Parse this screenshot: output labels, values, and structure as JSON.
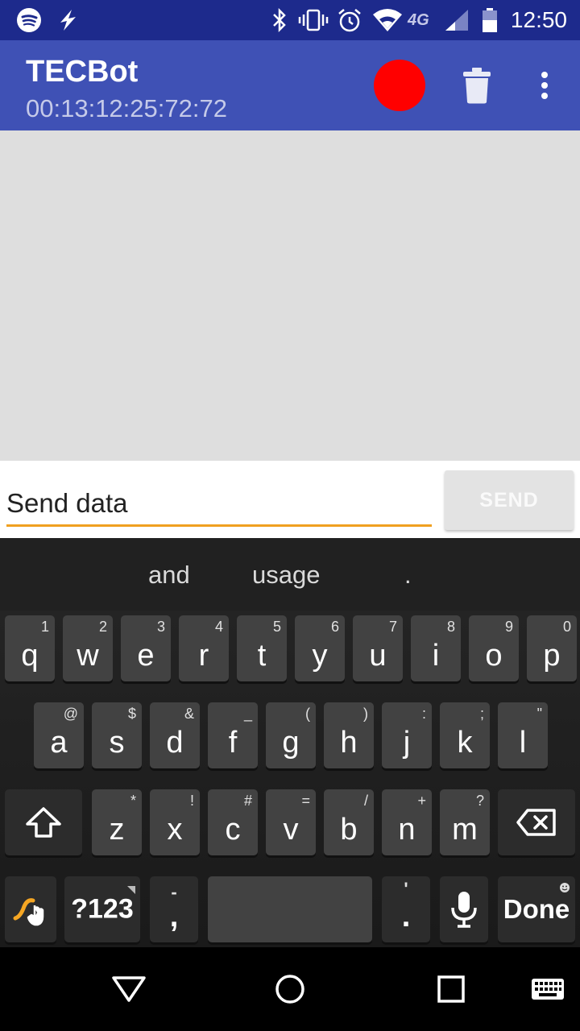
{
  "status_bar": {
    "time": "12:50",
    "network_label": "4G",
    "icons": [
      "spotify-icon",
      "flash-icon",
      "bluetooth-icon",
      "vibrate-icon",
      "alarm-icon",
      "wifi-icon",
      "lte-icon",
      "signal-icon",
      "battery-icon"
    ]
  },
  "app_bar": {
    "title": "TECBot",
    "subtitle": "00:13:12:25:72:72",
    "record_color": "#ff0000",
    "actions": [
      "record-button",
      "trash-icon",
      "more-vert-icon"
    ]
  },
  "composer": {
    "input_value": "",
    "input_placeholder": "Send data",
    "send_label": "SEND"
  },
  "keyboard": {
    "suggestions": [
      "and",
      "usage",
      "."
    ],
    "row1": [
      {
        "key": "q",
        "hint": "1"
      },
      {
        "key": "w",
        "hint": "2"
      },
      {
        "key": "e",
        "hint": "3"
      },
      {
        "key": "r",
        "hint": "4"
      },
      {
        "key": "t",
        "hint": "5"
      },
      {
        "key": "y",
        "hint": "6"
      },
      {
        "key": "u",
        "hint": "7"
      },
      {
        "key": "i",
        "hint": "8"
      },
      {
        "key": "o",
        "hint": "9"
      },
      {
        "key": "p",
        "hint": "0"
      }
    ],
    "row2": [
      {
        "key": "a",
        "hint": "@"
      },
      {
        "key": "s",
        "hint": "$"
      },
      {
        "key": "d",
        "hint": "&"
      },
      {
        "key": "f",
        "hint": "_"
      },
      {
        "key": "g",
        "hint": "("
      },
      {
        "key": "h",
        "hint": ")"
      },
      {
        "key": "j",
        "hint": ":"
      },
      {
        "key": "k",
        "hint": ";"
      },
      {
        "key": "l",
        "hint": "\""
      }
    ],
    "row3": [
      {
        "key": "z",
        "hint": "*"
      },
      {
        "key": "x",
        "hint": "!"
      },
      {
        "key": "c",
        "hint": "#"
      },
      {
        "key": "v",
        "hint": "="
      },
      {
        "key": "b",
        "hint": "/"
      },
      {
        "key": "n",
        "hint": "+"
      },
      {
        "key": "m",
        "hint": "?"
      }
    ],
    "symbols_label": "?123",
    "comma_label": ",",
    "comma_hint": "-",
    "period_label": ".",
    "period_hint": "'",
    "done_label": "Done",
    "accent_color": "#f5a623"
  },
  "nav_bar": {
    "buttons": [
      "back-icon",
      "home-icon",
      "recents-icon",
      "keyboard-switch-icon"
    ]
  }
}
